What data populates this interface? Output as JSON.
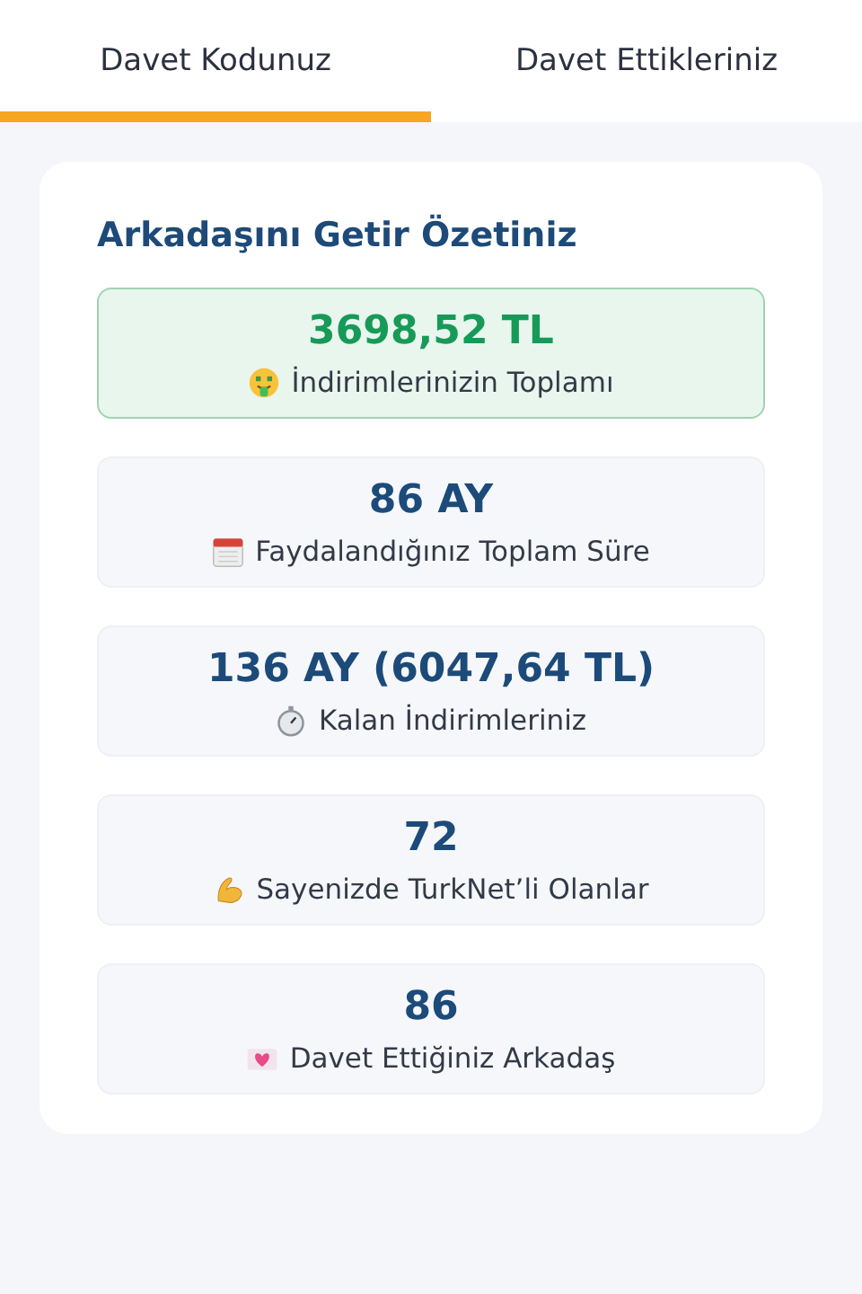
{
  "tabs": [
    {
      "label": "Davet Kodunuz",
      "selected": true
    },
    {
      "label": "Davet Ettikleriniz",
      "selected": false
    }
  ],
  "summary": {
    "title": "Arkadaşını Getir Özetiniz",
    "stats": [
      {
        "kind": "highlight",
        "value": "3698,52 TL",
        "label": "İndirimlerinizin Toplamı"
      },
      {
        "kind": "plain",
        "value": "86 AY",
        "label": "Faydalandığınız Toplam Süre"
      },
      {
        "kind": "plain",
        "value": "136 AY (6047,64 TL)",
        "label": "Kalan İndirimleriniz"
      },
      {
        "kind": "plain",
        "value": "72",
        "label": "Sayenizde TurkNet’li Olanlar"
      },
      {
        "kind": "plain",
        "value": "86",
        "label": "Davet Ettiğiniz Arkadaş"
      }
    ]
  }
}
